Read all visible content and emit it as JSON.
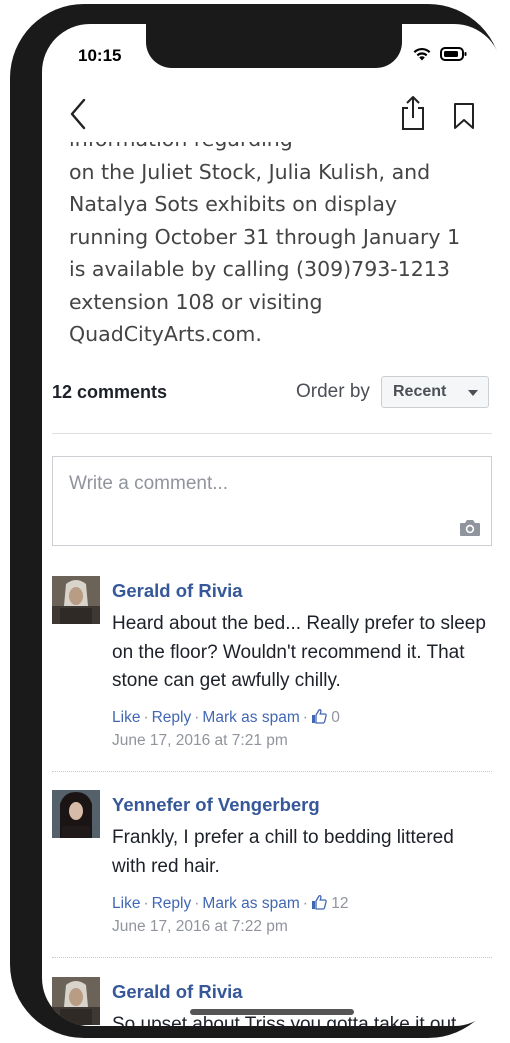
{
  "status_bar": {
    "time": "10:15"
  },
  "article": {
    "partial_line": "information regarding",
    "lines": [
      "on the Juliet Stock, Julia Kulish, and",
      "Natalya Sots exhibits on display",
      "running October 31 through January 1",
      "is available by calling (309)793-1213",
      "extension 108 or visiting",
      "QuadCityArts.com."
    ]
  },
  "comments_section": {
    "count_label": "12 comments",
    "order_label": "Order by",
    "order_value": "Recent",
    "input_placeholder": "Write a comment..."
  },
  "actions": {
    "like": "Like",
    "reply": "Reply",
    "spam": "Mark as spam",
    "dot": "·"
  },
  "comments": [
    {
      "author": "Gerald of Rivia",
      "text": "Heard about the bed... Really prefer to sleep on the floor? Wouldn't recommend it. That stone can get awfully chilly.",
      "likes": "0",
      "date": "June 17, 2016 at 7:21 pm"
    },
    {
      "author": "Yennefer of Vengerberg",
      "text": "Frankly, I prefer a chill to bedding littered with red hair.",
      "likes": "12",
      "date": "June 17, 2016 at 7:22 pm"
    },
    {
      "author": "Gerald of Rivia",
      "text": "So upset about Triss you gotta take it out"
    }
  ],
  "icons": {
    "back": "chevron-left-icon",
    "share": "share-icon",
    "bookmark": "bookmark-icon",
    "camera": "camera-icon",
    "thumb": "thumbs-up-icon",
    "wifi": "wifi-icon",
    "battery": "battery-icon"
  },
  "colors": {
    "link": "#4267b2",
    "author": "#365899",
    "muted": "#90949c",
    "body_text": "#444444"
  }
}
